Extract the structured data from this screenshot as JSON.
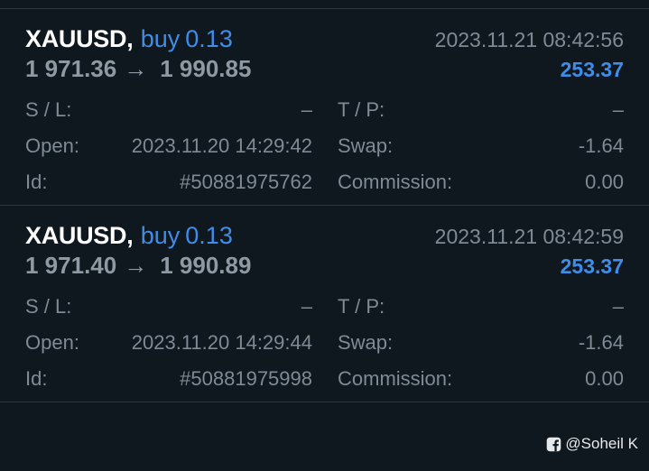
{
  "trades": [
    {
      "symbol": "XAUUSD",
      "comma": ",",
      "side": "buy",
      "volume": "0.13",
      "open_price": "1 971.36",
      "arrow": "→",
      "current_price": "1 990.85",
      "time": "2023.11.21 08:42:56",
      "profit": "253.37",
      "sl_label": "S / L:",
      "sl_value": "–",
      "tp_label": "T / P:",
      "tp_value": "–",
      "open_label": "Open:",
      "open_value": "2023.11.20 14:29:42",
      "swap_label": "Swap:",
      "swap_value": "-1.64",
      "id_label": "Id:",
      "id_value": "#50881975762",
      "commission_label": "Commission:",
      "commission_value": "0.00"
    },
    {
      "symbol": "XAUUSD",
      "comma": ",",
      "side": "buy",
      "volume": "0.13",
      "open_price": "1 971.40",
      "arrow": "→",
      "current_price": "1 990.89",
      "time": "2023.11.21 08:42:59",
      "profit": "253.37",
      "sl_label": "S / L:",
      "sl_value": "–",
      "tp_label": "T / P:",
      "tp_value": "–",
      "open_label": "Open:",
      "open_value": "2023.11.20 14:29:44",
      "swap_label": "Swap:",
      "swap_value": "-1.64",
      "id_label": "Id:",
      "id_value": "#50881975998",
      "commission_label": "Commission:",
      "commission_value": "0.00"
    }
  ],
  "watermark": {
    "icon": "facebook-icon",
    "text": "@Soheil K"
  },
  "colors": {
    "background": "#0f171f",
    "accent": "#3e8ee9",
    "symbol": "#ffffff",
    "muted": "#7f8a95"
  }
}
